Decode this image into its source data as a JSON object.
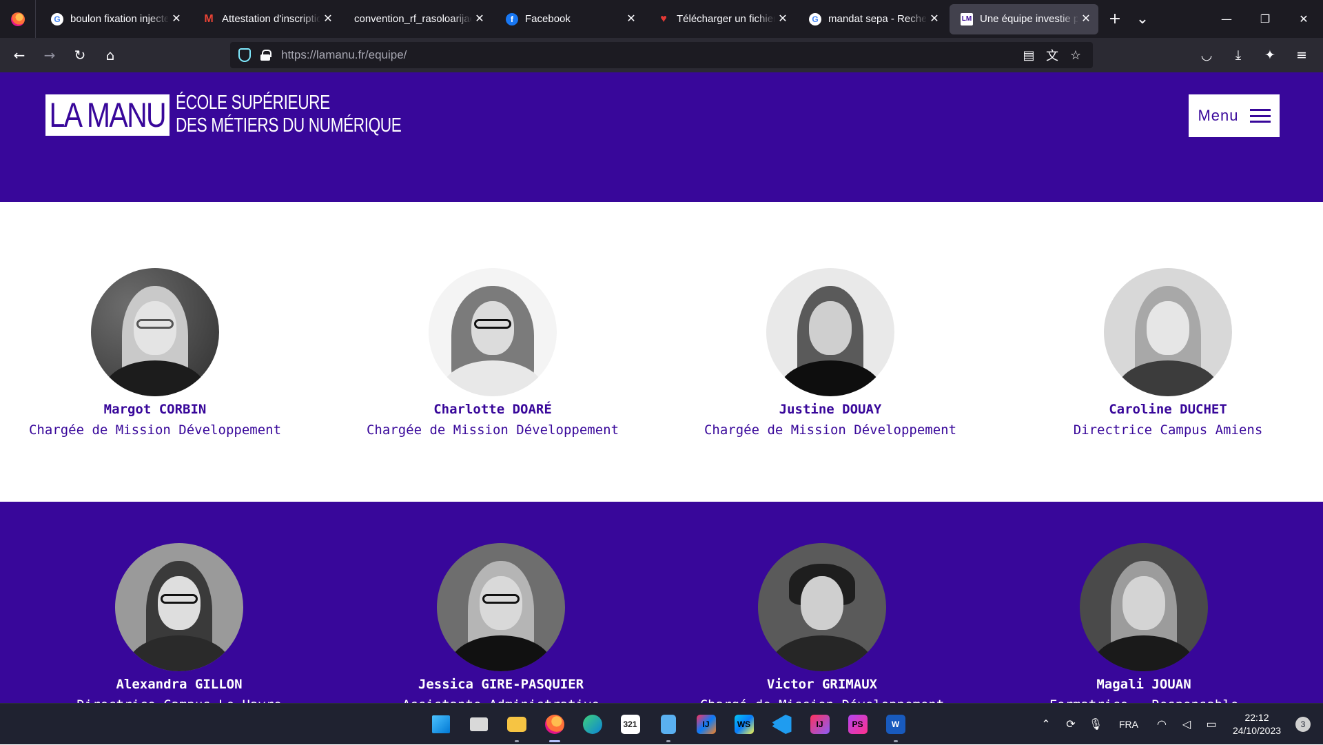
{
  "browser": {
    "tabs": [
      {
        "title": "boulon fixation injecte",
        "favicon": "google-icon",
        "active": false
      },
      {
        "title": "Attestation d'inscriptio",
        "favicon": "gmail-icon",
        "active": false
      },
      {
        "title": "convention_rf_rasoloarijao",
        "favicon": "none",
        "active": false
      },
      {
        "title": "Facebook",
        "favicon": "facebook-icon",
        "active": false
      },
      {
        "title": "Télécharger un fichier",
        "favicon": "heart-icon",
        "active": false
      },
      {
        "title": "mandat sepa - Recher",
        "favicon": "google-icon",
        "active": false
      },
      {
        "title": "Une équipe investie po",
        "favicon": "lamanu-icon",
        "active": true
      }
    ],
    "url": {
      "host": "https://lamanu.fr",
      "path": "/equipe/"
    }
  },
  "site": {
    "logo": {
      "mark": "LA MANU",
      "line1": "ÉCOLE SUPÉRIEURE",
      "line2": "DES MÉTIERS DU NUMÉRIQUE"
    },
    "menu_label": "Menu",
    "brand_color": "#38079a"
  },
  "team_row1": [
    {
      "name": "Margot CORBIN",
      "role": "Chargée de Mission Développement"
    },
    {
      "name": "Charlotte DOARÉ",
      "role": "Chargée de Mission Développement"
    },
    {
      "name": "Justine DOUAY",
      "role": "Chargée de Mission Développement"
    },
    {
      "name": "Caroline DUCHET",
      "role": "Directrice Campus Amiens"
    }
  ],
  "team_row2": [
    {
      "name": "Alexandra GILLON",
      "role": "Directrice Campus Le Havre"
    },
    {
      "name": "Jessica GIRE-PASQUIER",
      "role": "Assistante Administrative"
    },
    {
      "name": "Victor GRIMAUX",
      "role": "Chargé de Mission Développement"
    },
    {
      "name": "Magali JOUAN",
      "role": "Formatrice - Responsable"
    }
  ],
  "taskbar": {
    "apps": [
      "windows-start-icon",
      "task-view-icon",
      "file-explorer-icon",
      "firefox-icon",
      "edge-icon",
      "calendar-app-icon",
      "notepad-icon",
      "intellij-icon",
      "webstorm-icon",
      "vscode-icon",
      "intellij-ultimate-icon",
      "phpstorm-icon",
      "word-icon"
    ],
    "language": "FRA",
    "time": "22:12",
    "date": "24/10/2023",
    "notifications": "3"
  }
}
